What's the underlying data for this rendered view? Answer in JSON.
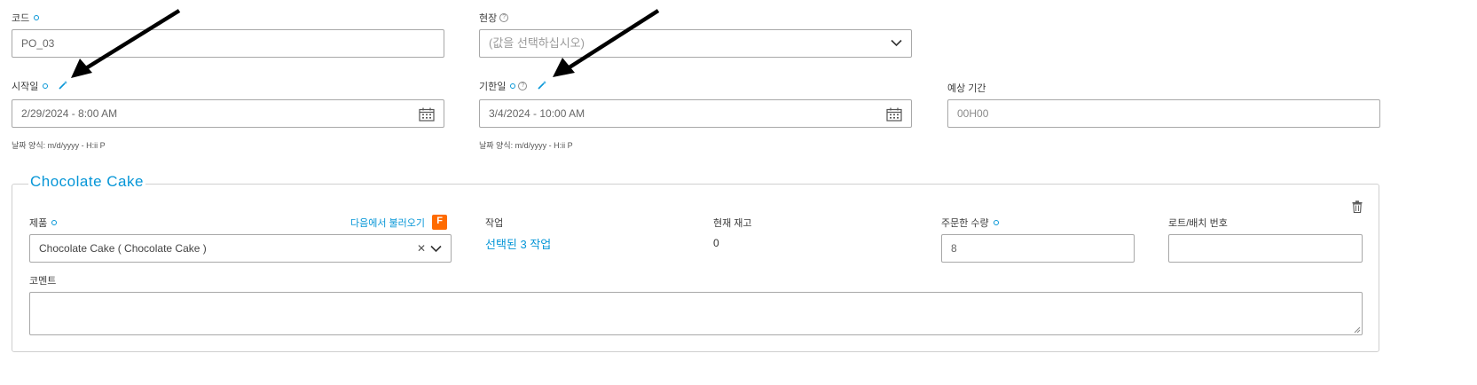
{
  "code": {
    "label": "코드",
    "value": "PO_03"
  },
  "site": {
    "label": "현장",
    "placeholder": "(값을 선택하십시오)"
  },
  "start_date": {
    "label": "시작일",
    "value": "2/29/2024 - 8:00 AM",
    "hint": "날짜 양식: m/d/yyyy - H:ii P"
  },
  "due_date": {
    "label": "기한일",
    "value": "3/4/2024 - 10:00 AM",
    "hint": "날짜 양식: m/d/yyyy - H:ii P"
  },
  "expected_duration": {
    "label": "예상 기간",
    "placeholder": "00H00"
  },
  "product_block": {
    "title": "Chocolate Cake",
    "product_label": "제품",
    "import_link": "다음에서 불러오기",
    "import_badge": "F",
    "product_value": "Chocolate Cake ( Chocolate Cake )",
    "tasks_label": "작업",
    "tasks_link": "선택된 3 작업",
    "stock_label": "현재 재고",
    "stock_value": "0",
    "ordered_qty_label": "주문한 수량",
    "ordered_qty_value": "8",
    "lot_label": "로트/배치 번호",
    "lot_value": "",
    "comment_label": "코멘트",
    "comment_value": ""
  },
  "colors": {
    "accent": "#0696d7",
    "border": "#a8a8a8",
    "badge": "#ff6b00"
  },
  "icons": [
    "required-dot-icon",
    "help-icon",
    "magic-wand-icon",
    "calendar-icon",
    "chevron-down-icon",
    "clear-x-icon",
    "trash-icon",
    "import-badge-icon"
  ]
}
